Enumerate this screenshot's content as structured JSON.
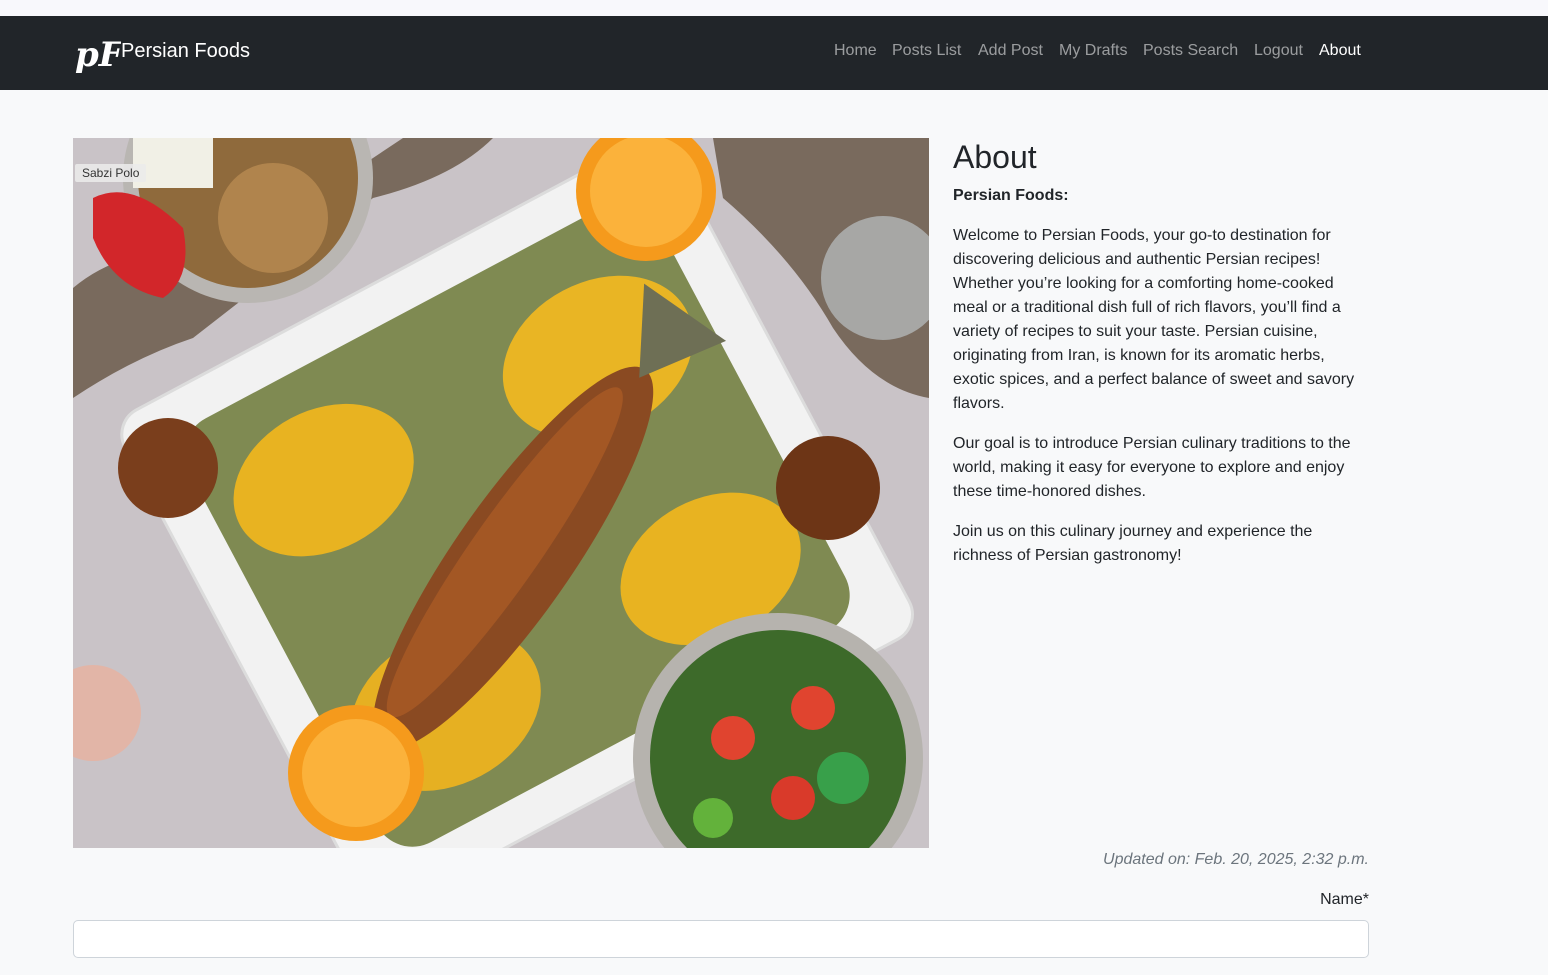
{
  "brand": {
    "name": "Persian Foods",
    "logo_text": "pF"
  },
  "nav": {
    "items": [
      {
        "label": "Home"
      },
      {
        "label": "Posts List"
      },
      {
        "label": "Add Post"
      },
      {
        "label": "My Drafts"
      },
      {
        "label": "Posts Search"
      },
      {
        "label": "Logout"
      },
      {
        "label": "About",
        "active": true
      }
    ]
  },
  "image": {
    "caption": "Sabzi Polo"
  },
  "about": {
    "title": "About",
    "subtitle": "Persian Foods:",
    "paragraphs": [
      "Welcome to Persian Foods, your go-to destination for discovering delicious and authentic Persian recipes! Whether you’re looking for a comforting home-cooked meal or a traditional dish full of rich flavors, you’ll find a variety of recipes to suit your taste. Persian cuisine, originating from Iran, is known for its aromatic herbs, exotic spices, and a perfect balance of sweet and savory flavors.",
      "Our goal is to introduce Persian culinary traditions to the world, making it easy for everyone to explore and enjoy these time-honored dishes.",
      "Join us on this culinary journey and experience the richness of Persian gastronomy!"
    ]
  },
  "updated": "Updated on: Feb. 20, 2025, 2:32 p.m.",
  "form": {
    "name_label": "Name*",
    "name_value": ""
  },
  "colors": {
    "navbar": "#212529",
    "nav_inactive": "#a6a8aa",
    "nav_active": "#ffffff",
    "page_bg": "#f8f9fa",
    "muted": "#6c757d"
  }
}
